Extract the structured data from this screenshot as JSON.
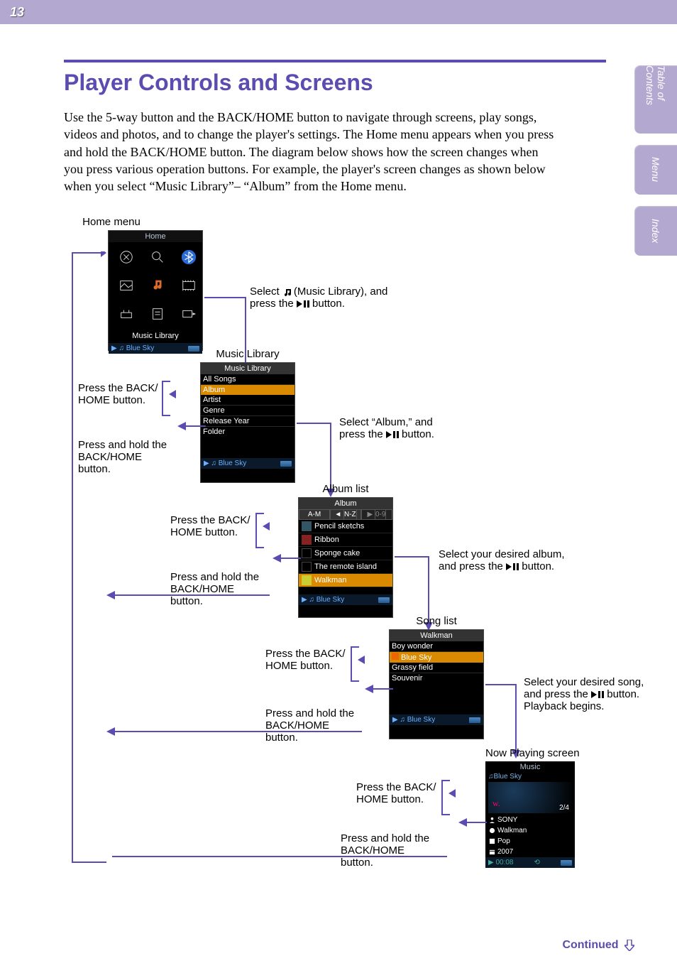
{
  "page_number": "13",
  "side_tabs": [
    "Table of\nContents",
    "Menu",
    "Index"
  ],
  "title": "Player Controls and Screens",
  "intro": "Use the 5-way button and the BACK/HOME button to navigate through screens, play songs, videos and photos, and to change the player's settings. The Home menu appears when you press and hold the BACK/HOME button. The diagram below shows how the screen changes when you press various operation buttons. For example, the player's screen changes as shown below when you select “Music Library”– “Album” from the Home menu.",
  "captions": {
    "home_menu": "Home menu",
    "music_library": "Music Library",
    "album_list": "Album list",
    "song_list": "Song list",
    "now_playing": "Now Playing screen",
    "press_back": "Press the BACK/\nHOME button.",
    "press_hold": "Press and hold the\nBACK/HOME button.",
    "step1a": "Select ",
    "step1b": "(Music Library), and press the ",
    "step1c": " button.",
    "step2a": "Select “Album,” and press the ",
    "step2b": " button.",
    "step3a": "Select your desired album, and press the ",
    "step3b": " button.",
    "step4a": "Select your desired song, and press the ",
    "step4b": " button. Playback begins."
  },
  "screens": {
    "home": {
      "title": "Home",
      "label": "Music Library",
      "now_playing": "Blue Sky"
    },
    "library": {
      "title": "Music Library",
      "items": [
        "All Songs",
        "Album",
        "Artist",
        "Genre",
        "Release Year",
        "Folder"
      ],
      "selected": 1,
      "now_playing": "Blue Sky"
    },
    "album": {
      "title": "Album",
      "tabs": [
        "A-M",
        "N-Z",
        "0-9"
      ],
      "items": [
        "Pencil sketchs",
        "Ribbon",
        "Sponge cake",
        "The remote island",
        "Walkman"
      ],
      "selected": 4,
      "now_playing": "Blue Sky"
    },
    "songs": {
      "title": "Walkman",
      "items": [
        "Boy wonder",
        "Blue Sky",
        "Grassy field",
        "Souvenir"
      ],
      "selected": 1,
      "now_playing": "Blue Sky"
    },
    "nowplaying": {
      "title": "Music",
      "song": "Blue Sky",
      "counter": "2/4",
      "artist": "SONY",
      "album": "Walkman",
      "genre": "Pop",
      "year": "2007",
      "time": "00:08"
    }
  },
  "continued": "Continued"
}
